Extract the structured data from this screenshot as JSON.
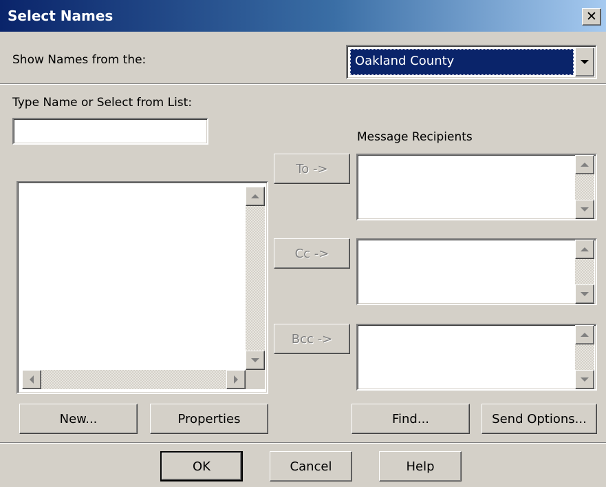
{
  "window": {
    "title": "Select Names",
    "close_glyph": "✕"
  },
  "show_names": {
    "label": "Show Names from the:",
    "selected": "Oakland County"
  },
  "search": {
    "label": "Type Name or Select from List:",
    "value": "",
    "placeholder": ""
  },
  "recipients": {
    "header": "Message Recipients",
    "to_button": "To ->",
    "cc_button": "Cc ->",
    "bcc_button": "Bcc ->"
  },
  "left_buttons": {
    "new": "New...",
    "properties": "Properties"
  },
  "right_buttons": {
    "find": "Find...",
    "send_options": "Send Options..."
  },
  "footer": {
    "ok": "OK",
    "cancel": "Cancel",
    "help": "Help"
  },
  "icons": {
    "close": "close-icon",
    "dropdown": "chevron-down-icon",
    "scroll_up": "scroll-up-arrow-icon",
    "scroll_down": "scroll-down-arrow-icon",
    "scroll_left": "scroll-left-arrow-icon",
    "scroll_right": "scroll-right-arrow-icon"
  },
  "colors": {
    "titlebar_start": "#0a246a",
    "titlebar_end": "#a6caf0",
    "face": "#d4d0c8",
    "selection": "#0a246a"
  }
}
